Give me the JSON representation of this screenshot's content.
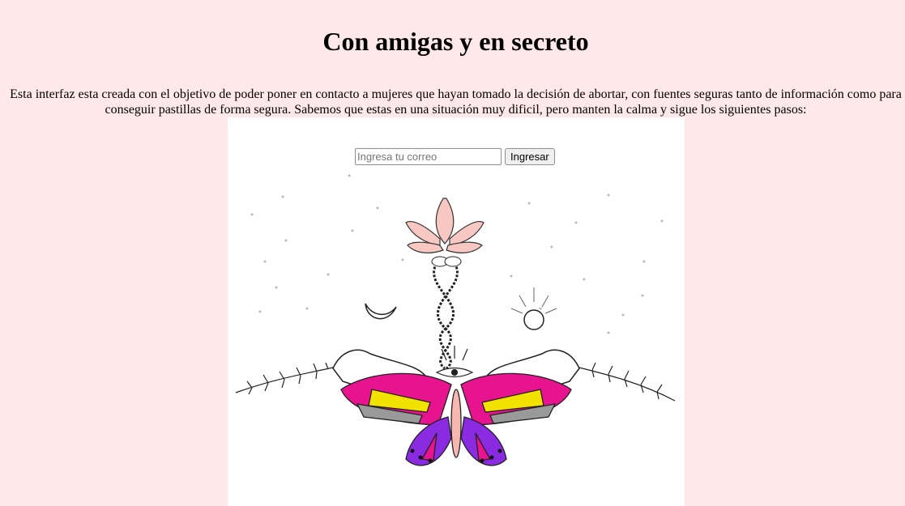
{
  "header": {
    "title": "Con amigas y en secreto"
  },
  "intro": {
    "text": "Esta interfaz esta creada con el objetivo de poder poner en contacto a mujeres que hayan tomado la decisión de abortar, con fuentes seguras tanto de información como para conseguir pastillas de forma segura. Sabemos que estas en una situación muy dificil, pero manten la calma y sigue los siguientes pasos:"
  },
  "login": {
    "email_placeholder": "Ingresa tu correo",
    "email_value": "",
    "submit_label": "Ingresar"
  },
  "illustration": {
    "colors": {
      "magenta": "#e8138f",
      "purple": "#8a2be2",
      "yellow": "#f2e200",
      "orange": "#f28c28",
      "pink": "#f7b6b0",
      "gray": "#9a9a9a"
    }
  }
}
